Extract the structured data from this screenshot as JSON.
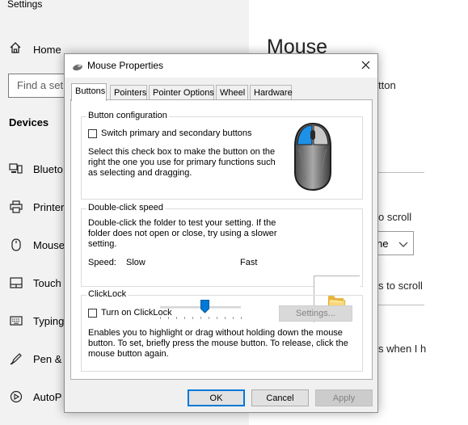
{
  "settings": {
    "title": "Settings",
    "home": "Home",
    "search_placeholder": "Find a set",
    "devices_heading": "Devices",
    "nav": [
      {
        "label": "Blueto",
        "icon": "bluetooth-devices-icon"
      },
      {
        "label": "Printer",
        "icon": "printer-icon"
      },
      {
        "label": "Mouse",
        "icon": "mouse-icon"
      },
      {
        "label": "Touch",
        "icon": "touchpad-icon"
      },
      {
        "label": "Typing",
        "icon": "keyboard-icon"
      },
      {
        "label": "Pen &",
        "icon": "pen-icon"
      },
      {
        "label": "AutoP",
        "icon": "autoplay-icon"
      }
    ],
    "main": {
      "heading": "Mouse",
      "text1": "tton",
      "text2": "o scroll",
      "select_value": "ne",
      "text3": "s to scroll",
      "text4": "s when I h"
    }
  },
  "dialog": {
    "title": "Mouse Properties",
    "tabs": [
      "Buttons",
      "Pointers",
      "Pointer Options",
      "Wheel",
      "Hardware"
    ],
    "active_tab": "Buttons",
    "button_config": {
      "title": "Button configuration",
      "checkbox_label": "Switch primary and secondary buttons",
      "checked": false,
      "description": [
        "Select this check box to make the button on the",
        "right the one you use for primary functions such",
        "as selecting and dragging."
      ]
    },
    "double_click": {
      "title": "Double-click speed",
      "description": [
        "Double-click the folder to test your setting. If the",
        "folder does not open or close, try using a slower",
        "setting."
      ],
      "speed_label": "Speed:",
      "slow_label": "Slow",
      "fast_label": "Fast",
      "speed_value": 0.55
    },
    "clicklock": {
      "title": "ClickLock",
      "checkbox_label": "Turn on ClickLock",
      "checked": false,
      "settings_button": "Settings...",
      "description": [
        "Enables you to highlight or drag without holding down the mouse",
        "button. To set, briefly press the mouse button. To release, click the",
        "mouse button again."
      ]
    },
    "buttons": {
      "ok": "OK",
      "cancel": "Cancel",
      "apply": "Apply"
    }
  },
  "colors": {
    "accent": "#0078d7",
    "sidebar_bg": "#f2f2f2",
    "dialog_bg": "#f0f0f0"
  }
}
